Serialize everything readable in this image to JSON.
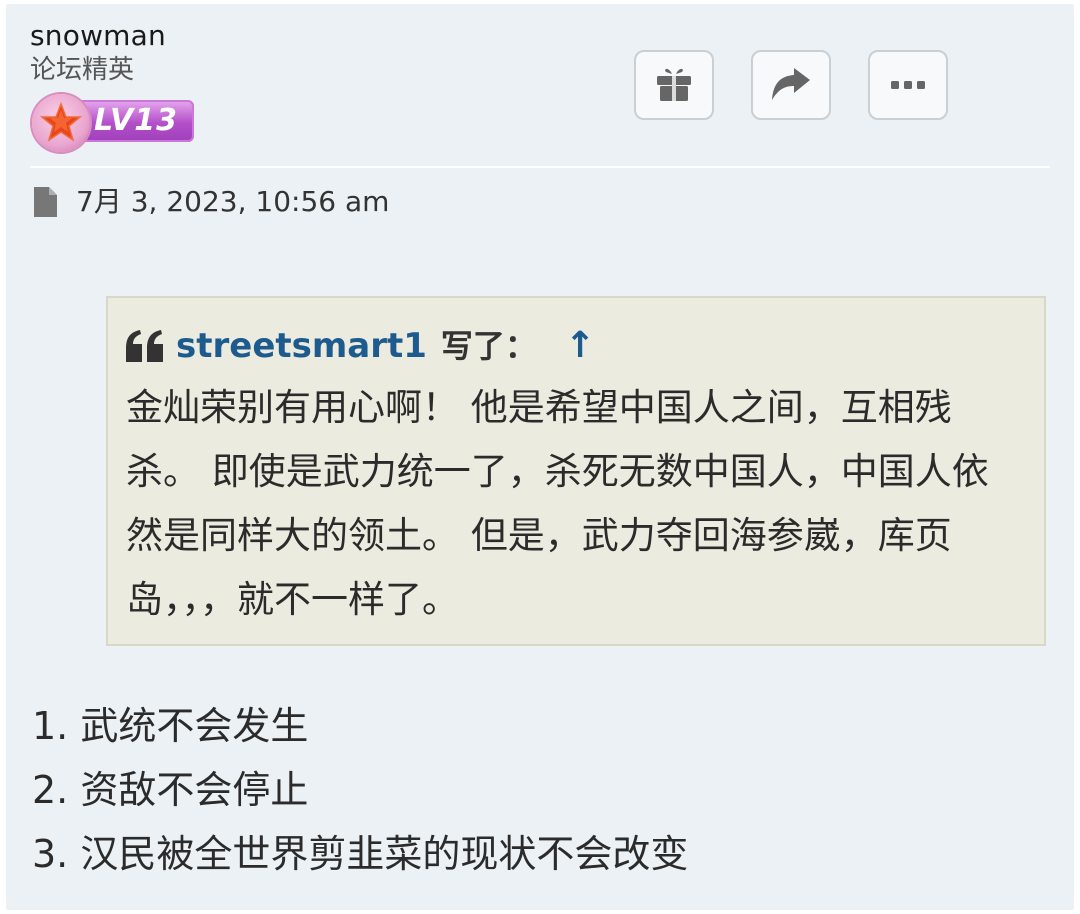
{
  "post": {
    "username": "snowman",
    "rank_title": "论坛精英",
    "level_badge": "LV13",
    "date": "7月 3, 2023, 10:56 am"
  },
  "actions": [
    {
      "name": "gift",
      "icon": "gift-icon"
    },
    {
      "name": "share",
      "icon": "share-arrow-icon"
    },
    {
      "name": "more",
      "icon": "more-dots-icon"
    }
  ],
  "quote": {
    "author": "streetsmart1",
    "wrote_label": "写了：",
    "jump_symbol": "↑",
    "text": "金灿荣别有用心啊！ 他是希望中国人之间，互相残杀。 即使是武力统一了，杀死无数中国人，中国人依然是同样大的领土。 但是，武力夺回海参崴，库页岛，，，就不一样了。"
  },
  "list": [
    {
      "num": "1.",
      "text": "武统不会发生"
    },
    {
      "num": "2.",
      "text": "资敌不会停止"
    },
    {
      "num": "3.",
      "text": "汉民被全世界剪韭菜的现状不会改变"
    }
  ],
  "colors": {
    "background": "#ebf1f5",
    "quote_bg": "#ecebdf",
    "link": "#1d5a8e",
    "badge": "#b34fc9"
  }
}
